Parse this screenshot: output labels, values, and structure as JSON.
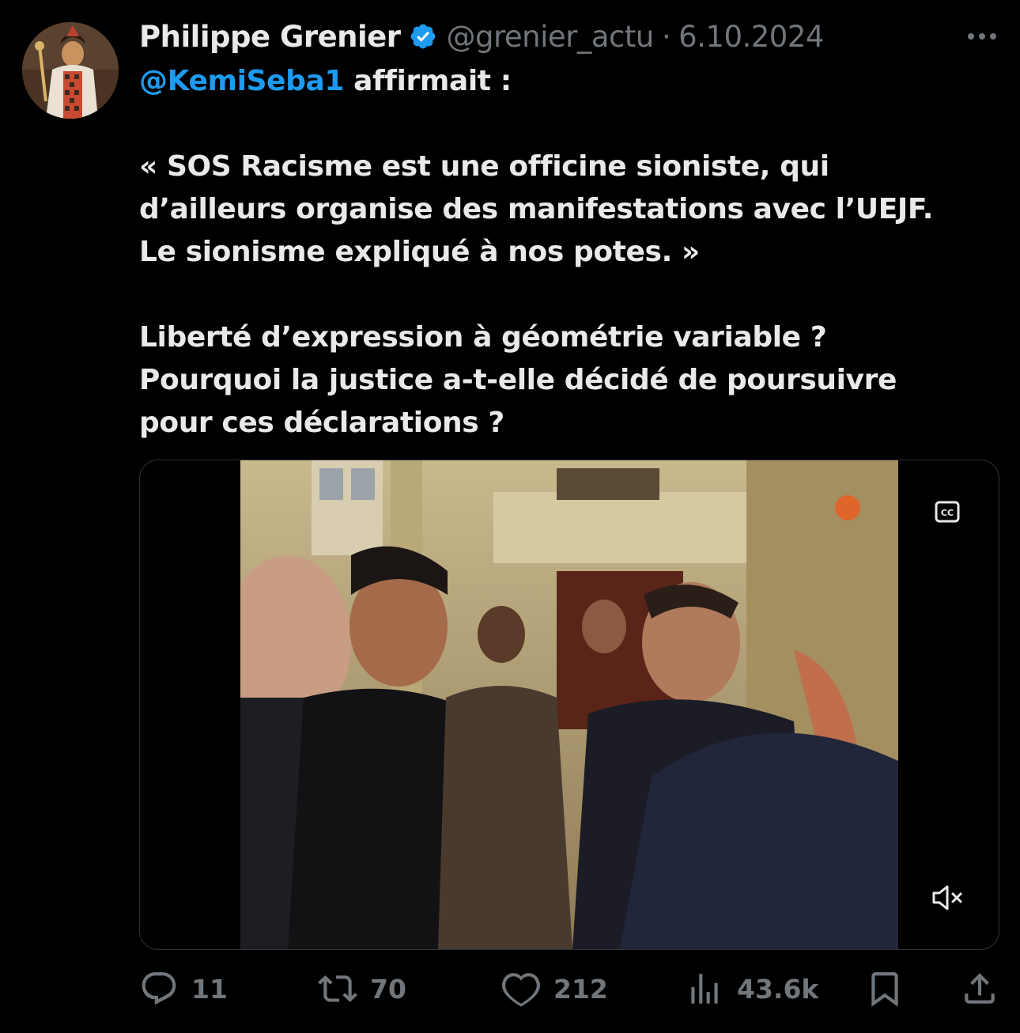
{
  "tweet": {
    "author": {
      "name": "Philippe Grenier",
      "handle": "@grenier_actu",
      "verified": true,
      "avatar_icon": "portrait-avatar"
    },
    "separator": "·",
    "date": "6.10.2024",
    "more_icon": "more-icon",
    "text": {
      "mention": "@KemiSeba1",
      "intro_rest": "affirmait :",
      "quote_lines": [
        "« SOS Racisme est une officine sioniste, qui",
        "d’ailleurs organise des manifestations avec l’UEJF.",
        "Le sionisme expliqué à nos potes. »"
      ],
      "question_lines": [
        "Liberté d’expression à géométrie variable ?",
        "Pourquoi la justice a-t-elle décidé de poursuivre",
        "pour ces déclarations ?"
      ]
    },
    "media": {
      "type": "video",
      "cc_icon": "captions-icon",
      "mute_icon": "muted-speaker-icon"
    },
    "actions": {
      "replies": "11",
      "retweets": "70",
      "likes": "212",
      "views": "43.6k"
    }
  },
  "colors": {
    "background": "#000000",
    "text_primary": "#e7e9ea",
    "text_secondary": "#71767b",
    "accent": "#1d9bf0",
    "border": "#2f3336"
  }
}
